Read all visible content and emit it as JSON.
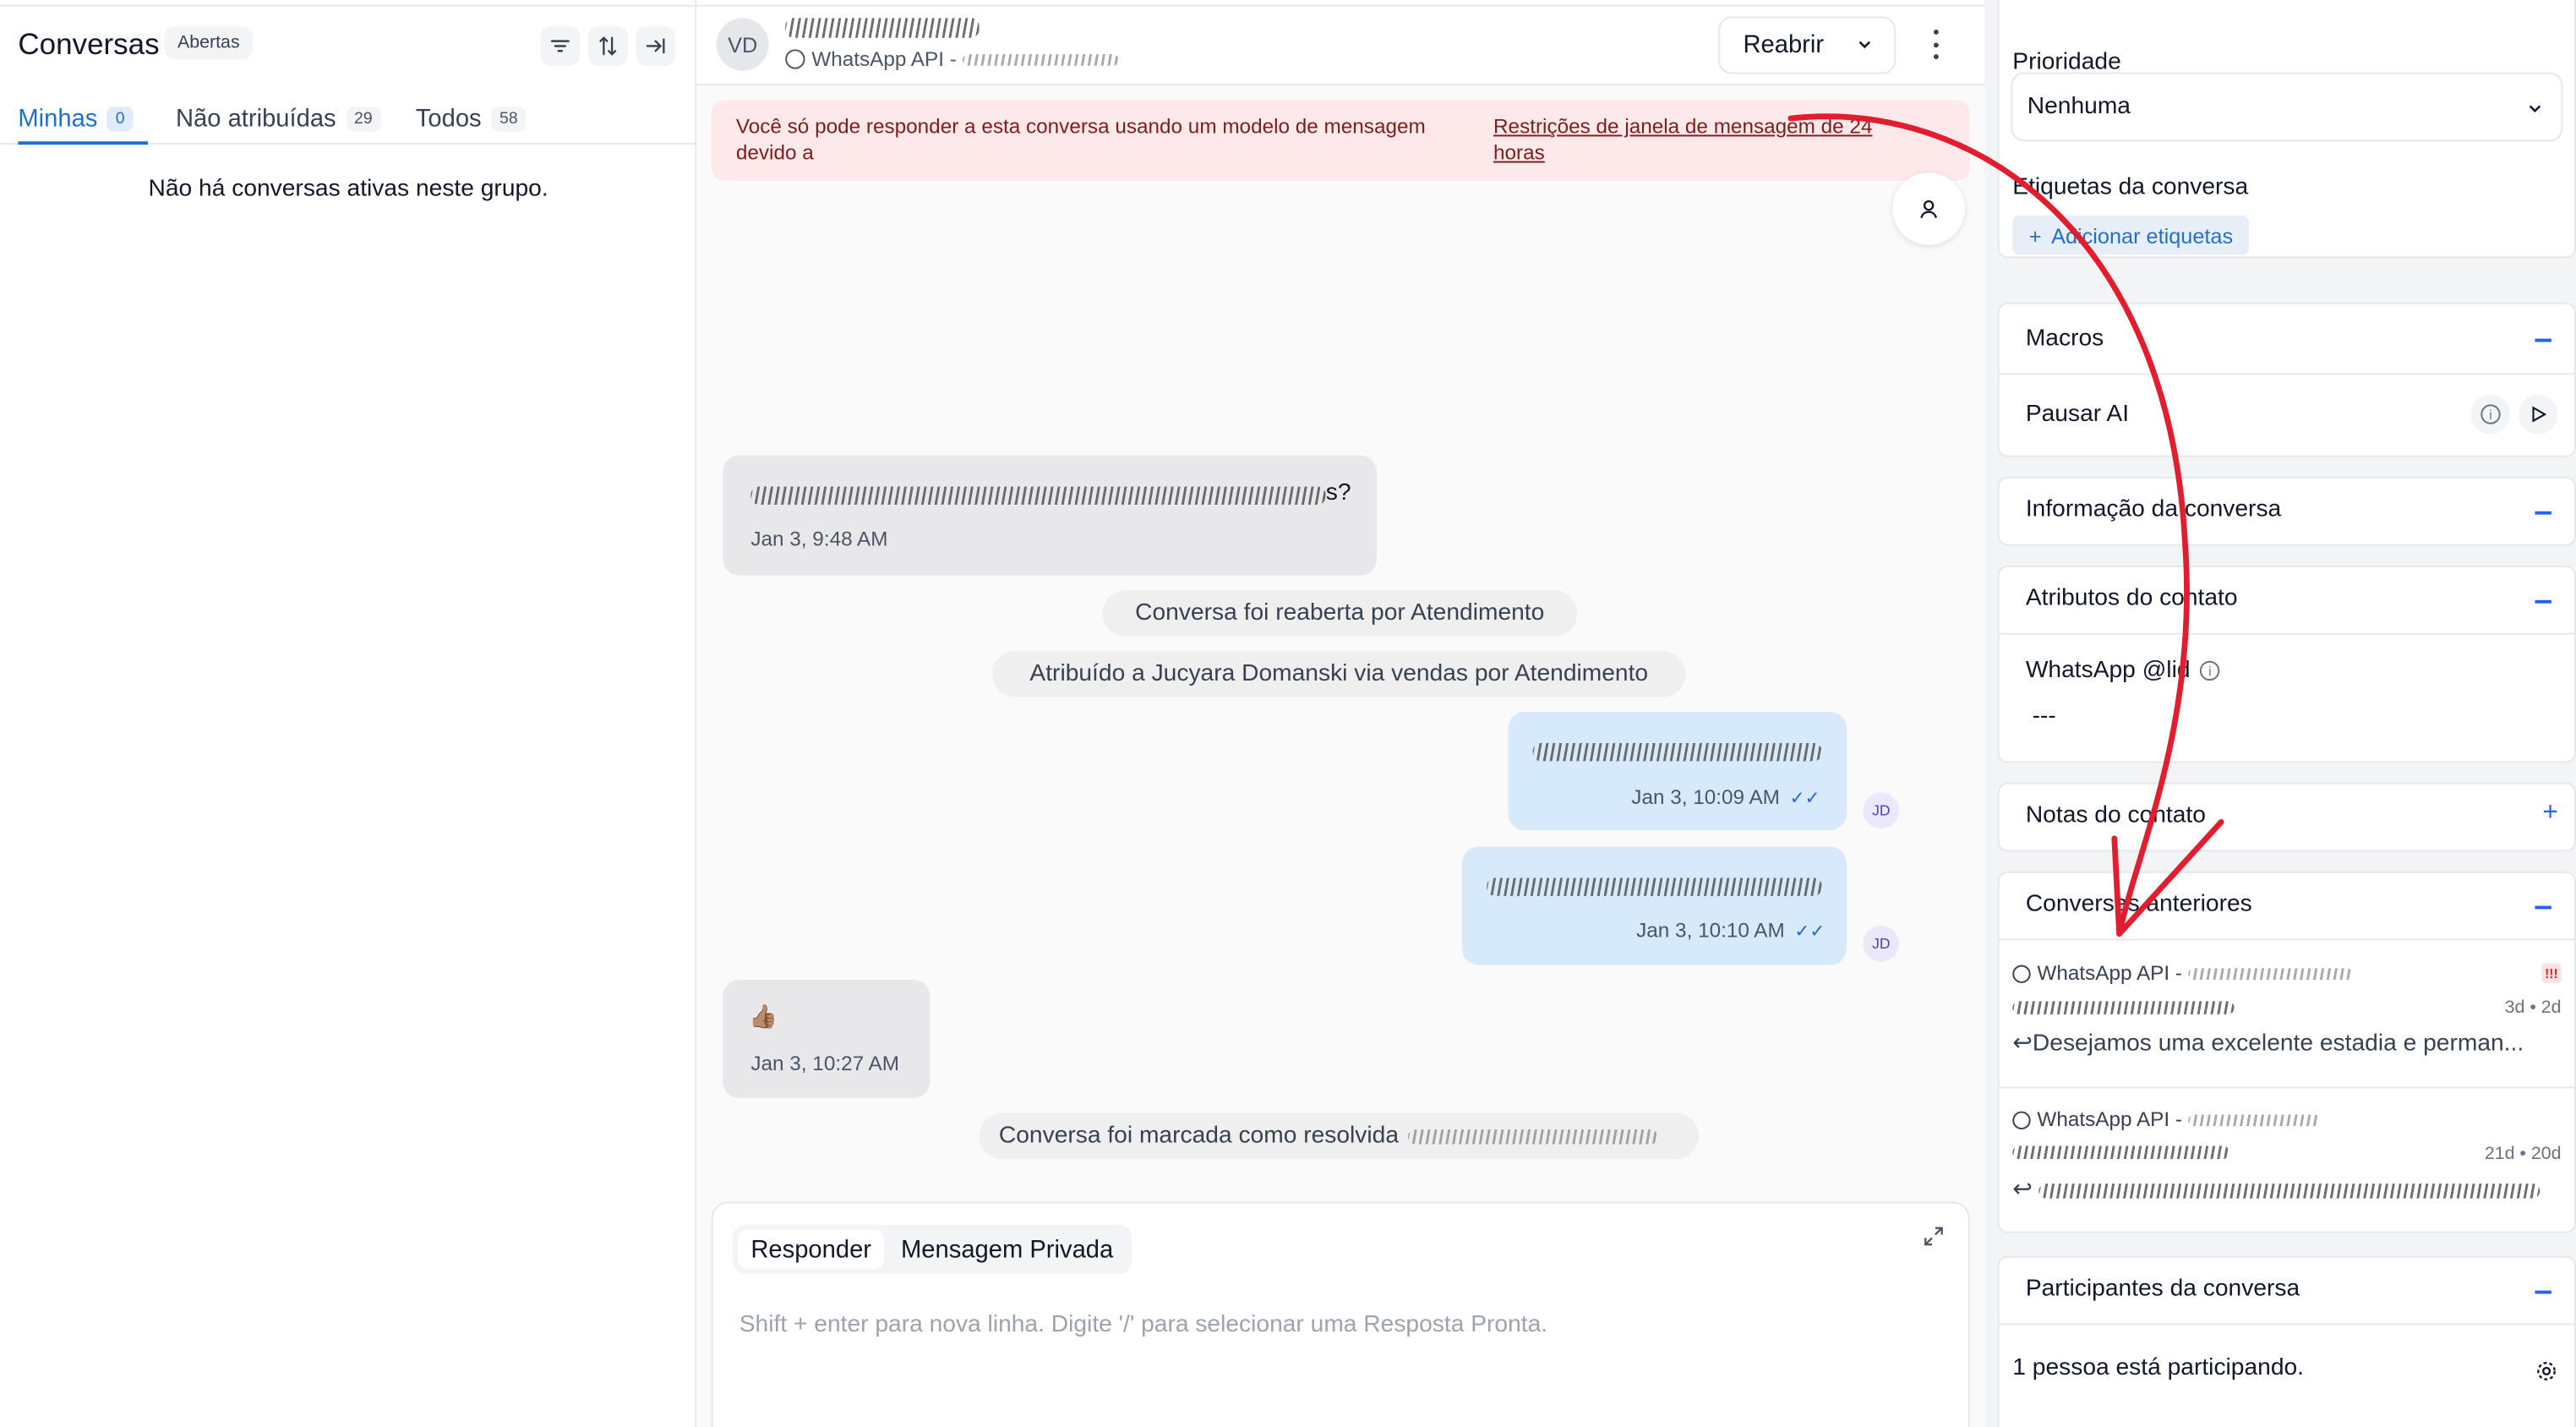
{
  "left_panel": {
    "title": "Conversas",
    "status_badge": "Abertas",
    "tabs": [
      {
        "label": "Minhas",
        "count": "0"
      },
      {
        "label": "Não atribuídas",
        "count": "29"
      },
      {
        "label": "Todos",
        "count": "58"
      }
    ],
    "empty_message": "Não há conversas ativas neste grupo."
  },
  "header": {
    "avatar_initials": "VD",
    "channel": "WhatsApp API -",
    "reopen_label": "Reabrir"
  },
  "alert": {
    "text": "Você só pode responder a esta conversa usando um modelo de mensagem devido a",
    "link": "Restrições de janela de mensagem de 24 horas"
  },
  "messages": {
    "in1_suffix": "s?",
    "in1_time": "Jan 3, 9:48 AM",
    "sys1": "Conversa foi reaberta por Atendimento",
    "sys2": "Atribuído a Jucyara Domanski via vendas por Atendimento",
    "out1_time": "Jan 3, 10:09 AM",
    "out2_time": "Jan 3, 10:10 AM",
    "agent_initials": "JD",
    "in2_emoji": "👍🏽",
    "in2_time": "Jan 3, 10:27 AM",
    "sys3": "Conversa foi marcada como resolvida"
  },
  "composer": {
    "reply_tab": "Responder",
    "private_tab": "Mensagem Privada",
    "placeholder": "Shift + enter para nova linha. Digite '/' para selecionar uma Resposta Pronta."
  },
  "sidebar": {
    "priority_label": "Prioridade",
    "priority_value": "Nenhuma",
    "labels_title": "Etiquetas da conversa",
    "add_labels": "Adicionar etiquetas",
    "macros_title": "Macros",
    "macro_item": "Pausar AI",
    "conv_info_title": "Informação da conversa",
    "contact_attrs_title": "Atributos do contato",
    "whatsapp_attr": "WhatsApp @lid",
    "whatsapp_attr_value": "---",
    "contact_notes_title": "Notas do contato",
    "previous_title": "Conversas anteriores",
    "previous": [
      {
        "channel": "WhatsApp API -",
        "time": "3d • 2d",
        "snippet": "Desejamos uma excelente estadia e perman..."
      },
      {
        "channel": "WhatsApp API -",
        "time": "21d • 20d",
        "snippet": ""
      }
    ],
    "participants_title": "Participantes da conversa",
    "participants_text": "1 pessoa está participando."
  },
  "colors": {
    "accent": "#1f6fd1",
    "alert_bg": "#fde8ea",
    "out_bubble": "#d7eafc",
    "annotation_arrow": "#e11d2e"
  }
}
